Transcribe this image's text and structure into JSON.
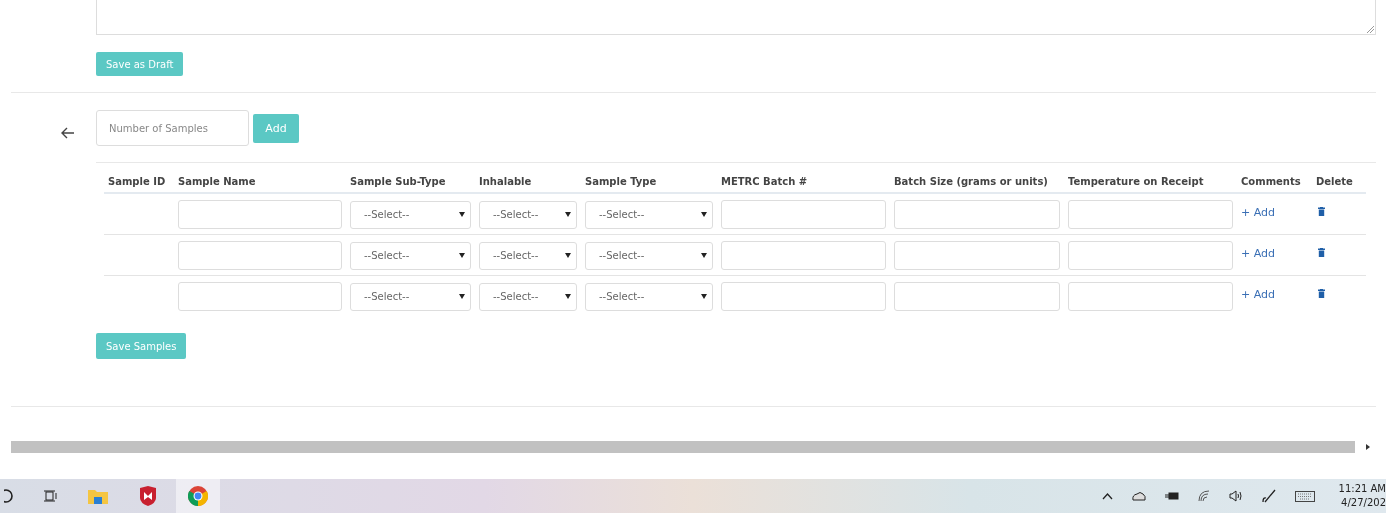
{
  "draft_button": "Save as Draft",
  "samples_form": {
    "placeholder": "Number of Samples",
    "add_button": "Add"
  },
  "table": {
    "columns": [
      "Sample ID",
      "Sample Name",
      "Sample Sub-Type",
      "Inhalable",
      "Sample Type",
      "METRC Batch #",
      "Batch Size (grams or units)",
      "Temperature on Receipt",
      "Comments",
      "Delete"
    ],
    "rows": [
      {
        "sub_type": "--Select--",
        "inhalable": "--Select--",
        "sample_type": "--Select--",
        "comment_link": "+ Add"
      },
      {
        "sub_type": "--Select--",
        "inhalable": "--Select--",
        "sample_type": "--Select--",
        "comment_link": "+ Add"
      },
      {
        "sub_type": "--Select--",
        "inhalable": "--Select--",
        "sample_type": "--Select--",
        "comment_link": "+ Add"
      }
    ]
  },
  "save_button": "Save Samples",
  "taskbar": {
    "time": "11:21 AM",
    "date": "4/27/202"
  }
}
